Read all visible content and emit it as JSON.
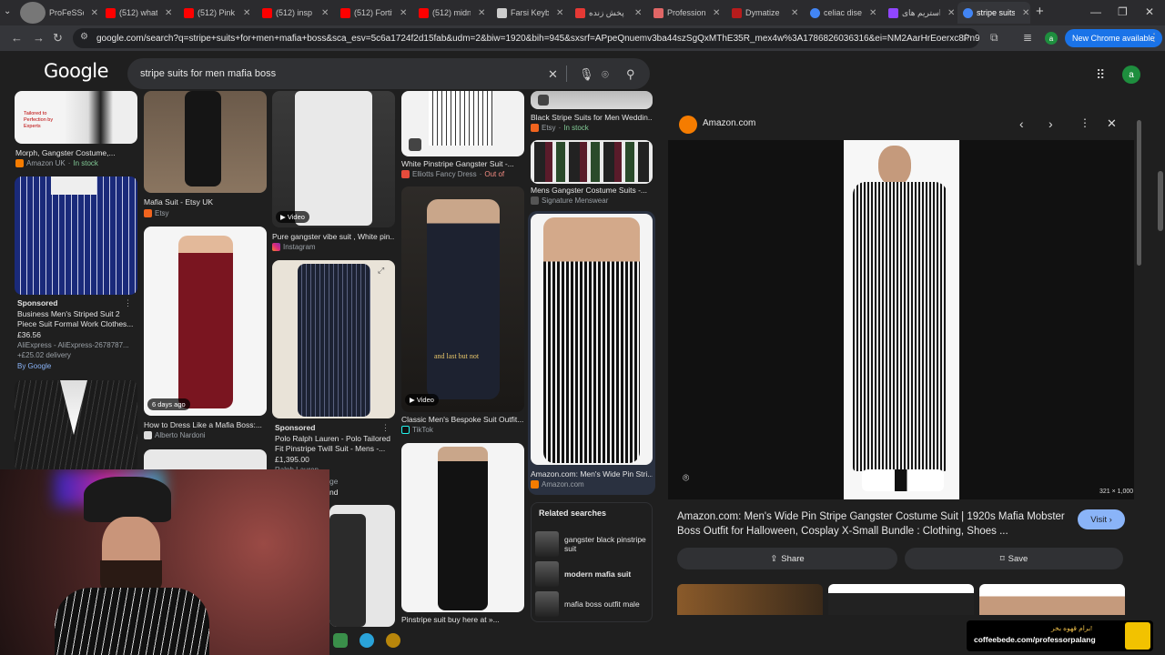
{
  "tabs": [
    {
      "label": "ProFeSSor",
      "color": "#a0a0a0"
    },
    {
      "label": "(512) what",
      "color": "#ff0000"
    },
    {
      "label": "(512) Pink",
      "color": "#ff0000"
    },
    {
      "label": "(512) insp",
      "color": "#ff0000"
    },
    {
      "label": "(512) Fortit",
      "color": "#ff0000"
    },
    {
      "label": "(512) midn",
      "color": "#ff0000"
    },
    {
      "label": "Farsi Keyb",
      "color": "#cccccc"
    },
    {
      "label": "پخش زنده",
      "color": "#e53935"
    },
    {
      "label": "Profession",
      "color": "#e06666"
    },
    {
      "label": "Dymatize",
      "color": "#b71c1c"
    },
    {
      "label": "celiac dise",
      "color": "#4285f4"
    },
    {
      "label": "استریم های",
      "color": "#9146ff"
    },
    {
      "label": "stripe suits",
      "color": "#4285f4"
    }
  ],
  "browser": {
    "url": "google.com/search?q=stripe+suits+for+men+mafia+boss&sca_esv=5c6a1724f2d15fab&udm=2&biw=1920&bih=945&sxsrf=APpeQnuemv3ba44szSgQxMThE35R_mex4w%3A1786826036316&ei=NM2AarHrEoerxc8Pn9ipoAM...",
    "new_chrome": "New Chrome available",
    "profile_letter": "a"
  },
  "google": {
    "logo": "Google",
    "query": "stripe suits for men mafia boss",
    "avatar_letter": "a"
  },
  "grid": {
    "c1": {
      "top_badge": "Tailored to Perfection by Experts",
      "item1_title": "Morph, Gangster Costume,...",
      "item1_source": "Amazon UK",
      "item1_stock": "In stock",
      "item2_sponsored": "Sponsored",
      "item2_title1": "Business Men's Striped Suit 2",
      "item2_title2": "Piece Suit Formal Work Clothes...",
      "item2_price": "£36.56",
      "item2_source": "AliExpress - AliExpress-2678787...",
      "item2_delivery": "+£25.02 delivery",
      "item2_by": "By Google"
    },
    "c2": {
      "item1_title": "Mafia Suit - Etsy UK",
      "item1_source": "Etsy",
      "item2_badge": "6 days ago",
      "item2_title": "How to Dress Like a Mafia Boss:...",
      "item2_source": "Alberto Nardoni"
    },
    "c3": {
      "item1_badge": "Video",
      "item1_title": "Pure gangster vibe suit , White pin...",
      "item1_source": "Instagram",
      "item2_sponsored": "Sponsored",
      "item2_title1": "Polo Ralph Lauren - Polo Tailored",
      "item2_title2": "Fit Pinstripe Twill Suit - Mens -...",
      "item2_price": "£1,395.00",
      "item2_source": "Ralph Lauren",
      "item2_extra1": "ge",
      "item2_extra2": "nd"
    },
    "c4": {
      "item1_title": "White Pinstripe Gangster Suit -...",
      "item1_source": "Elliotts Fancy Dress",
      "item1_stock": "Out of",
      "item2_overlay": "and last but not",
      "item2_badge": "Video",
      "item2_title": "Classic Men's Bespoke Suit Outfit...",
      "item2_source": "TikTok",
      "item3_title": "Pinstripe suit buy here at »..."
    },
    "c5": {
      "item1_title": "Black Stripe Suits for Men Weddin...",
      "item1_source": "Etsy",
      "item1_stock": "In stock",
      "item2_title": "Mens Gangster Costume Suits -...",
      "item2_source": "Signature Menswear",
      "item3_title": "Amazon.com: Men's Wide Pin Stri...",
      "item3_source": "Amazon.com"
    }
  },
  "related": {
    "heading": "Related searches",
    "items": [
      {
        "label": "gangster black pinstripe suit"
      },
      {
        "label": "modern mafia suit"
      },
      {
        "label": "mafia boss outfit male"
      }
    ]
  },
  "preview": {
    "source": "Amazon.com",
    "dimensions": "321 × 1,000",
    "title": "Amazon.com: Men's Wide Pin Stripe Gangster Costume Suit | 1920s Mafia Mobster Boss Outfit for Halloween, Cosplay X-Small Bundle : Clothing, Shoes ...",
    "visit": "Visit",
    "share": "Share",
    "save": "Save"
  },
  "overlay": {
    "coffee_fa": "برام قهوه بخر!",
    "coffee_url": "coffeebede.com/professorpalang"
  }
}
